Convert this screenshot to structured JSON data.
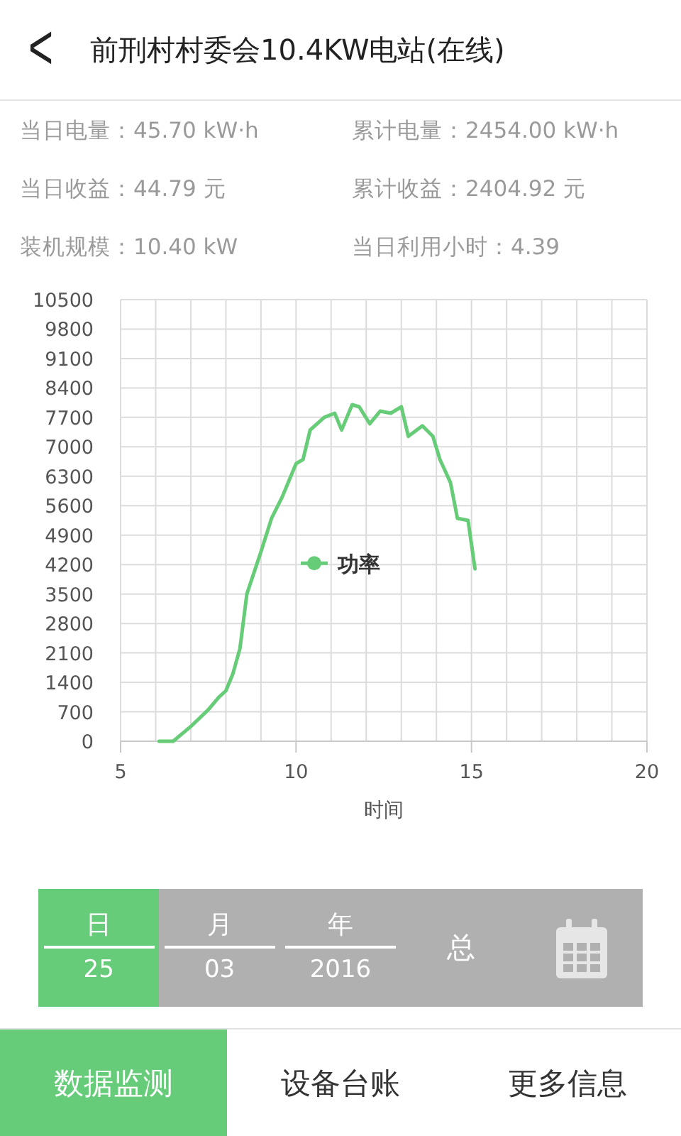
{
  "header": {
    "back": "<",
    "title": "前刑村村委会10.4KW电站(在线)"
  },
  "stats": [
    {
      "label": "当日电量：",
      "value": "45.70 kW·h"
    },
    {
      "label": "累计电量：",
      "value": "2454.00 kW·h"
    },
    {
      "label": "当日收益：",
      "value": "44.79 元"
    },
    {
      "label": "累计收益：",
      "value": "2404.92 元"
    },
    {
      "label": "装机规模：",
      "value": "10.40 kW"
    },
    {
      "label": "当日利用小时：",
      "value": "4.39"
    }
  ],
  "chart": {
    "chart_data": {
      "type": "line",
      "grid": true,
      "xlabel": "时间",
      "xlim": [
        5,
        20
      ],
      "ylim": [
        0,
        10500
      ],
      "xticks": [
        5,
        10,
        15,
        20
      ],
      "yticks": [
        0,
        700,
        1400,
        2100,
        2800,
        3500,
        4200,
        4900,
        5600,
        6300,
        7000,
        7700,
        8400,
        9100,
        9800,
        10500
      ],
      "x": [
        6.1,
        6.5,
        7.0,
        7.5,
        7.8,
        8.0,
        8.2,
        8.4,
        8.6,
        9.0,
        9.3,
        9.6,
        10.0,
        10.2,
        10.4,
        10.8,
        11.1,
        11.3,
        11.6,
        11.8,
        12.1,
        12.4,
        12.7,
        13.0,
        13.2,
        13.6,
        13.9,
        14.1,
        14.4,
        14.6,
        14.9,
        15.1
      ],
      "series": [
        {
          "name": "功率",
          "color": "#66cc77",
          "values": [
            0,
            0,
            350,
            750,
            1050,
            1200,
            1600,
            2200,
            3500,
            4500,
            5300,
            5800,
            6600,
            6700,
            7400,
            7700,
            7800,
            7400,
            8000,
            7950,
            7550,
            7850,
            7800,
            7950,
            7250,
            7500,
            7250,
            6700,
            6150,
            5300,
            5250,
            4100
          ]
        }
      ]
    }
  },
  "period": [
    {
      "kind": "field",
      "label": "日",
      "value": "25",
      "selected": true
    },
    {
      "kind": "field",
      "label": "月",
      "value": "03",
      "selected": false
    },
    {
      "kind": "field",
      "label": "年",
      "value": "2016",
      "selected": false
    },
    {
      "kind": "text",
      "label": "总",
      "selected": false
    },
    {
      "kind": "calendar",
      "selected": false
    }
  ],
  "tabs": [
    {
      "label": "数据监测",
      "selected": true
    },
    {
      "label": "设备台账",
      "selected": false
    },
    {
      "label": "更多信息",
      "selected": false
    }
  ]
}
